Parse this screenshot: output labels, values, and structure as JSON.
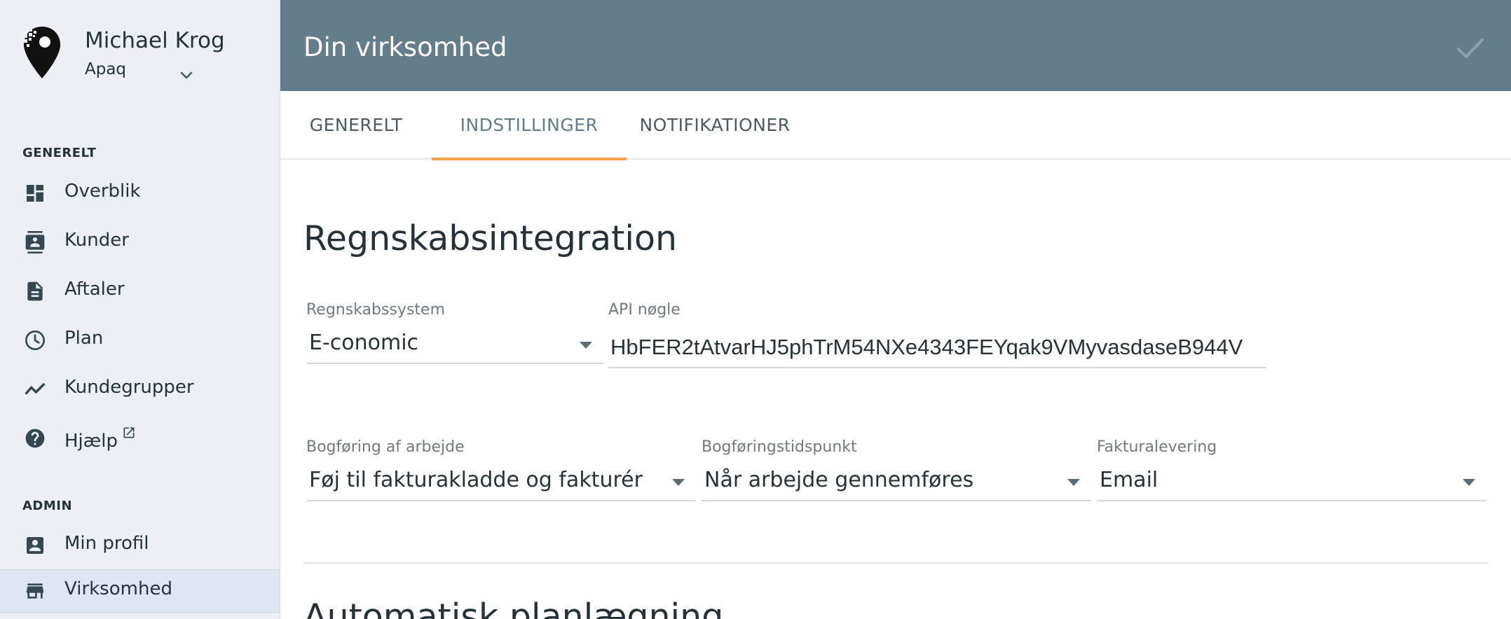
{
  "user": {
    "name": "Michael Krog",
    "company": "Apaq"
  },
  "sidebar": {
    "sections": [
      {
        "label": "GENERELT"
      },
      {
        "label": "ADMIN"
      }
    ],
    "items": [
      {
        "label": "Overblik",
        "icon": "dashboard-icon"
      },
      {
        "label": "Kunder",
        "icon": "contacts-icon"
      },
      {
        "label": "Aftaler",
        "icon": "document-icon"
      },
      {
        "label": "Plan",
        "icon": "clock-icon"
      },
      {
        "label": "Kundegrupper",
        "icon": "trending-icon"
      },
      {
        "label": "Hjælp",
        "icon": "help-icon",
        "external": true
      },
      {
        "label": "Min profil",
        "icon": "account-box-icon"
      },
      {
        "label": "Virksomhed",
        "icon": "store-icon",
        "active": true
      }
    ]
  },
  "header": {
    "title": "Din virksomhed"
  },
  "tabs": [
    {
      "label": "GENERELT"
    },
    {
      "label": "INDSTILLINGER",
      "active": true
    },
    {
      "label": "NOTIFIKATIONER"
    }
  ],
  "accounting": {
    "heading": "Regnskabsintegration",
    "system": {
      "label": "Regnskabssystem",
      "value": "E-conomic"
    },
    "api_key": {
      "label": "API nøgle",
      "value": "HbFER2tAtvarHJ5phTrM54NXe4343FEYqak9VMyvasdaseB944V"
    },
    "posting": {
      "label": "Bogføring af arbejde",
      "value": "Føj til fakturakladde og fakturér"
    },
    "posting_time": {
      "label": "Bogføringstidspunkt",
      "value": "Når arbejde gennemføres"
    },
    "invoice_delivery": {
      "label": "Fakturalevering",
      "value": "Email"
    }
  },
  "next_section": {
    "heading": "Automatisk planlægning"
  },
  "colors": {
    "topbar": "#647d8a",
    "sidebar": "#eceff3",
    "tab_indicator": "#f0a24a",
    "active_nav": "#dfe6f1"
  }
}
